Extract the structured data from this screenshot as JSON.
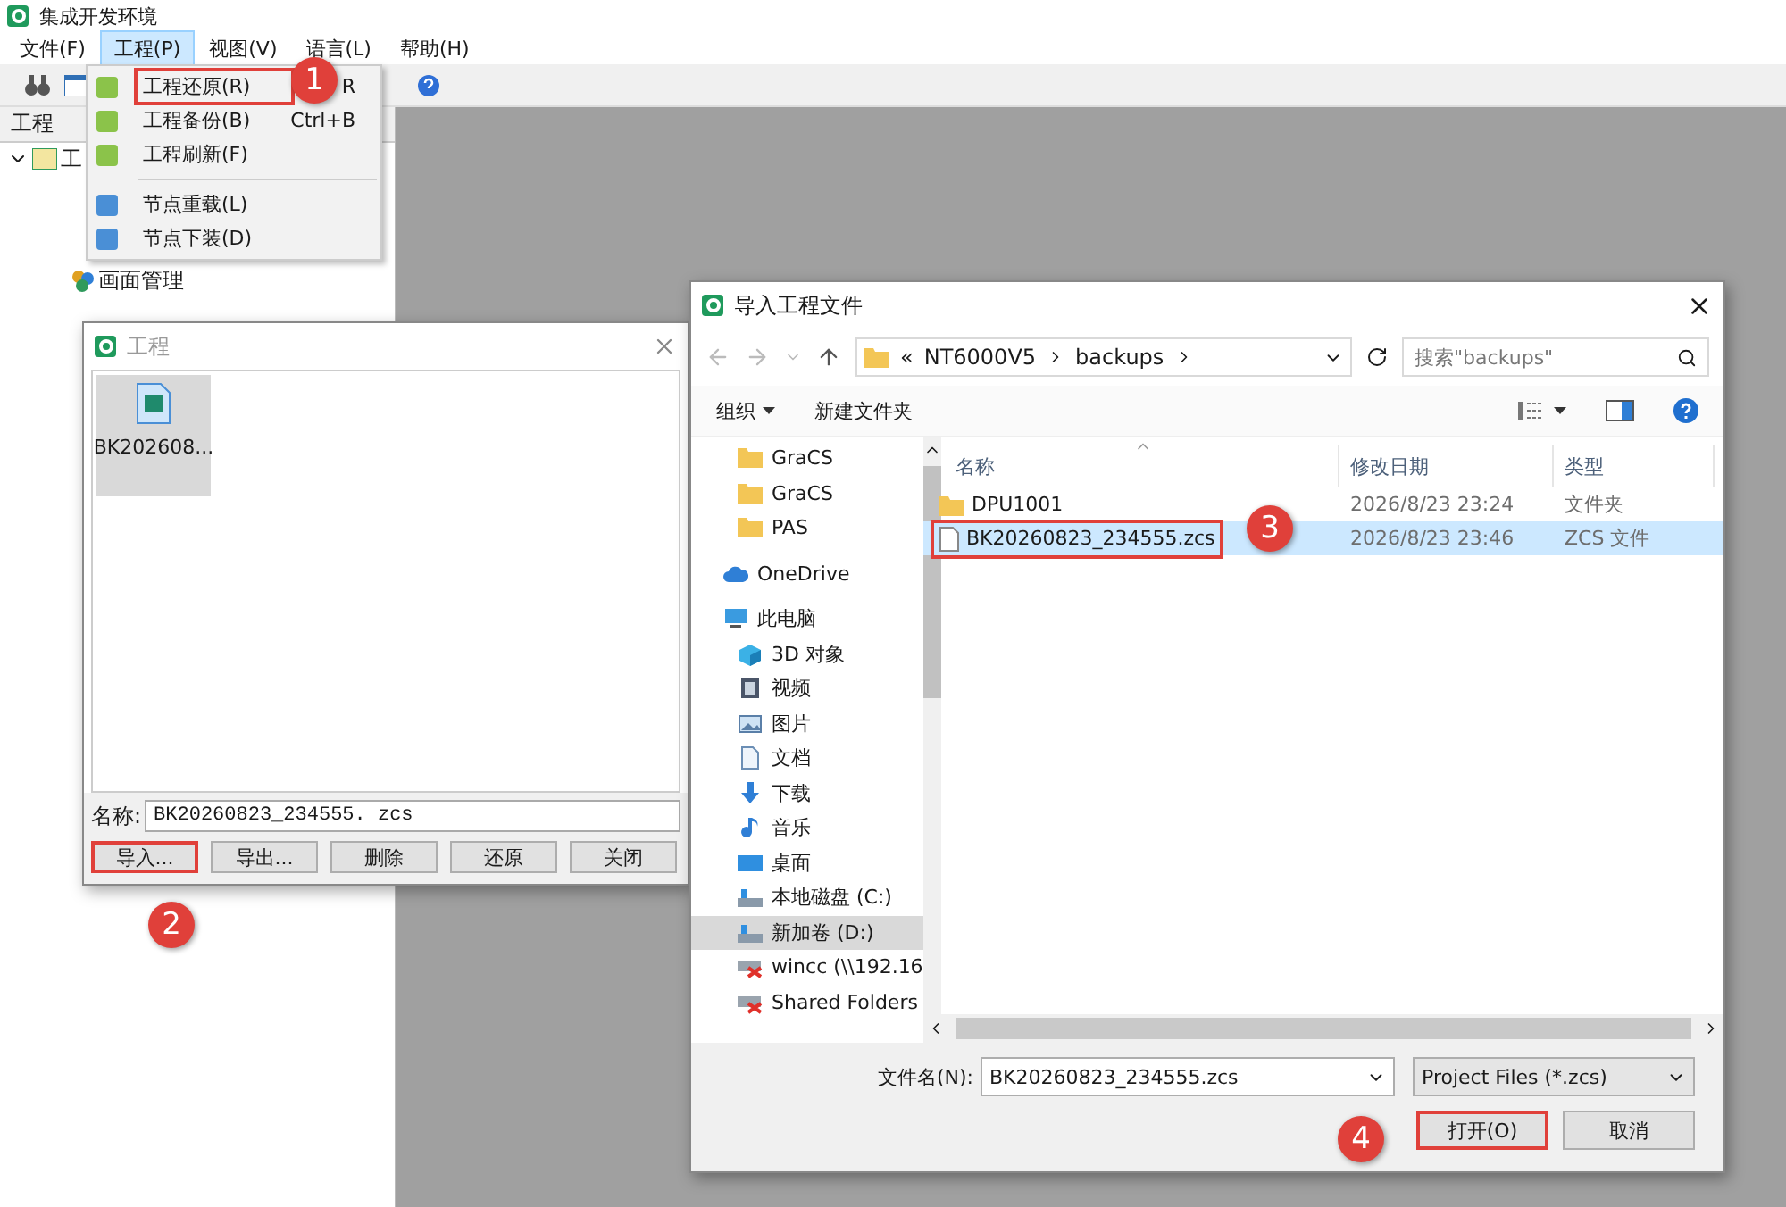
{
  "app": {
    "title": "集成开发环境",
    "menus": [
      {
        "label": "文件(F)",
        "selected": false
      },
      {
        "label": "工程(P)",
        "selected": true
      },
      {
        "label": "视图(V)",
        "selected": false
      },
      {
        "label": "语言(L)",
        "selected": false
      },
      {
        "label": "帮助(H)",
        "selected": false
      }
    ],
    "panel_title": "工程",
    "tree": [
      {
        "label": "工",
        "expanded": true,
        "children": [
          {
            "label": "画面管理"
          }
        ]
      }
    ]
  },
  "menu": {
    "items": [
      {
        "kind": "item",
        "label": "工程还原(R)",
        "shortcut": "R",
        "boxed": true
      },
      {
        "kind": "item",
        "label": "工程备份(B)",
        "shortcut": "Ctrl+B",
        "boxed": false
      },
      {
        "kind": "item",
        "label": "工程刷新(F)",
        "boxed": false
      },
      {
        "kind": "separator"
      },
      {
        "kind": "item",
        "label": "节点重载(L)",
        "boxed": false
      },
      {
        "kind": "item",
        "label": "节点下装(D)",
        "boxed": false
      }
    ]
  },
  "project_dialog": {
    "title": "工程",
    "files": [
      {
        "label": "BK202608...",
        "selected": true
      }
    ],
    "name_label": "名称:",
    "name_value": "BK20260823_234555. zcs",
    "buttons": [
      {
        "label": "导入...",
        "boxed": true
      },
      {
        "label": "导出...",
        "boxed": false
      },
      {
        "label": "删除",
        "boxed": false
      },
      {
        "label": "还原",
        "boxed": false
      },
      {
        "label": "关闭",
        "boxed": false
      }
    ]
  },
  "file_dialog": {
    "title": "导入工程文件",
    "breadcrumb_overflow": "«",
    "breadcrumb": [
      "NT6000V5",
      "backups"
    ],
    "search_placeholder": "搜索\"backups\"",
    "toolbar": [
      "组织",
      "新建文件夹"
    ],
    "nav_pane": {
      "continued_children": [
        {
          "label": "GraCS",
          "kind": "folder",
          "selected": false
        },
        {
          "label": "GraCS",
          "kind": "folder",
          "selected": false
        },
        {
          "label": "PAS",
          "kind": "folder",
          "selected": false
        }
      ],
      "items": [
        {
          "label": "OneDrive",
          "kind": "cloud",
          "selected": false
        },
        {
          "label": "此电脑",
          "kind": "pc",
          "selected": false,
          "children": [
            {
              "label": "3D 对象",
              "kind": "cube",
              "selected": false
            },
            {
              "label": "视频",
              "kind": "video",
              "selected": false
            },
            {
              "label": "图片",
              "kind": "pictures",
              "selected": false
            },
            {
              "label": "文档",
              "kind": "documents",
              "selected": false
            },
            {
              "label": "下载",
              "kind": "downloads",
              "selected": false
            },
            {
              "label": "音乐",
              "kind": "music",
              "selected": false
            },
            {
              "label": "桌面",
              "kind": "desktop",
              "selected": false
            },
            {
              "label": "本地磁盘 (C:)",
              "kind": "drive",
              "selected": false
            },
            {
              "label": "新加卷 (D:)",
              "kind": "drive",
              "selected": true
            },
            {
              "label": "wincc (\\\\192.16",
              "kind": "network",
              "selected": false
            },
            {
              "label": "Shared Folders",
              "kind": "network",
              "selected": false
            }
          ]
        }
      ]
    },
    "columns": [
      "名称",
      "修改日期",
      "类型"
    ],
    "files": [
      {
        "kind": "folder",
        "name": "DPU1001",
        "modified": "2026/8/23 23:24",
        "type": "文件夹",
        "selected": false,
        "boxed": false
      },
      {
        "kind": "file",
        "name": "BK20260823_234555.zcs",
        "modified": "2026/8/23 23:46",
        "type": "ZCS 文件",
        "selected": true,
        "boxed": true
      }
    ],
    "file_name_label": "文件名(N):",
    "file_name_value": "BK20260823_234555.zcs",
    "filter": "Project Files (*.zcs)",
    "buttons": [
      {
        "label": "打开(O)",
        "boxed": true
      },
      {
        "label": "取消",
        "boxed": false
      }
    ]
  },
  "annotations": [
    {
      "number": "1"
    },
    {
      "number": "2"
    },
    {
      "number": "3"
    },
    {
      "number": "4"
    }
  ]
}
